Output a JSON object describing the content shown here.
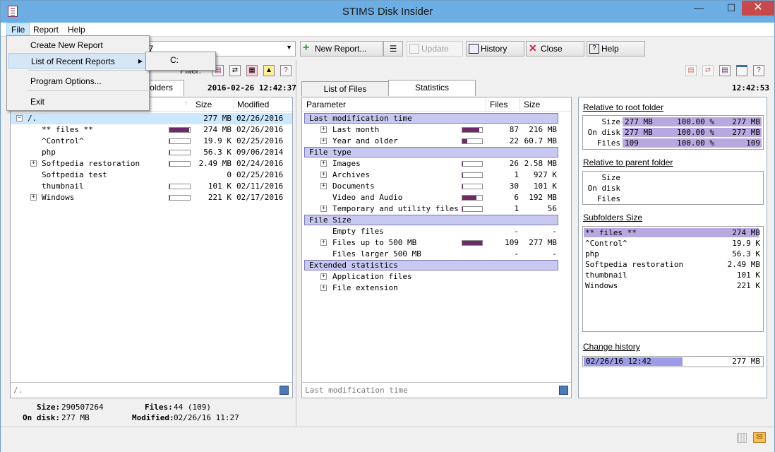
{
  "window": {
    "title": "STIMS Disk Insider"
  },
  "menubar": {
    "file": "File",
    "report": "Report",
    "help": "Help"
  },
  "file_menu": {
    "create": "Create New Report",
    "recent": "List of Recent Reports",
    "options": "Program Options...",
    "exit": "Exit"
  },
  "recent_submenu": {
    "item": "C:"
  },
  "toolbar": {
    "combo_value": "37",
    "new_report": "New Report...",
    "update": "Update",
    "history": "History",
    "close": "Close",
    "help": "Help"
  },
  "left": {
    "filter_label": "Filter:",
    "tab_folders": "olders",
    "datetime": "2016-02-26 12:42:37",
    "col_size": "Size",
    "col_modified": "Modified",
    "rows": [
      {
        "name": "/.",
        "size": "277 MB",
        "date": "02/26/2016",
        "fill": 0,
        "bar": false,
        "expand": "minus",
        "indent": 0
      },
      {
        "name": "** files **",
        "size": "274 MB",
        "date": "02/26/2016",
        "fill": 0.98,
        "bar": true,
        "expand": "",
        "indent": 1
      },
      {
        "name": "^Control^",
        "size": "19.9 K",
        "date": "02/25/2016",
        "fill": 0.02,
        "bar": true,
        "expand": "",
        "indent": 1
      },
      {
        "name": "php",
        "size": "56.3 K",
        "date": "09/06/2014",
        "fill": 0.02,
        "bar": true,
        "expand": "",
        "indent": 1
      },
      {
        "name": "Softpedia restoration",
        "size": "2.49 MB",
        "date": "02/24/2016",
        "fill": 0.03,
        "bar": true,
        "expand": "plus",
        "indent": 1
      },
      {
        "name": "Softpedia test",
        "size": "0",
        "date": "02/25/2016",
        "fill": 0,
        "bar": false,
        "expand": "",
        "indent": 1
      },
      {
        "name": "thumbnail",
        "size": "101 K",
        "date": "02/11/2016",
        "fill": 0.02,
        "bar": true,
        "expand": "",
        "indent": 1
      },
      {
        "name": "Windows",
        "size": "221 K",
        "date": "02/17/2016",
        "fill": 0.02,
        "bar": true,
        "expand": "plus",
        "indent": 1
      }
    ],
    "path": "/.",
    "info": {
      "size_label": "Size:",
      "size_val": "290507264",
      "ondisk_label": "On disk:",
      "ondisk_val": "277 MB",
      "files_label": "Files:",
      "files_val": "44 (109)",
      "modified_label": "Modified:",
      "modified_val": "02/26/16 11:27"
    }
  },
  "right": {
    "tab_files": "List of Files",
    "tab_stats": "Statistics",
    "time": "12:42:53",
    "col_param": "Parameter",
    "col_files": "Files",
    "col_size": "Size",
    "sections": [
      {
        "title": "Last modification time",
        "rows": [
          {
            "label": "Last month",
            "files": "87",
            "size": "216 MB",
            "fill": 0.85,
            "bar": true,
            "plus": true
          },
          {
            "label": "Year and older",
            "files": "22",
            "size": "60.7 MB",
            "fill": 0.25,
            "bar": true,
            "plus": true
          }
        ]
      },
      {
        "title": "File type",
        "rows": [
          {
            "label": "Images",
            "files": "26",
            "size": "2.58 MB",
            "fill": 0.02,
            "bar": true,
            "plus": true
          },
          {
            "label": "Archives",
            "files": "1",
            "size": "927 K",
            "fill": 0.02,
            "bar": true,
            "plus": true
          },
          {
            "label": "Documents",
            "files": "30",
            "size": "101 K",
            "fill": 0.02,
            "bar": true,
            "plus": true
          },
          {
            "label": "Video and Audio",
            "files": "6",
            "size": "192 MB",
            "fill": 0.7,
            "bar": true,
            "plus": false
          },
          {
            "label": "Temporary and utility files",
            "files": "1",
            "size": "56",
            "fill": 0.02,
            "bar": true,
            "plus": true
          }
        ]
      },
      {
        "title": "File Size",
        "rows": [
          {
            "label": "Empty files",
            "files": "-",
            "size": "-",
            "fill": 0,
            "bar": false,
            "plus": false
          },
          {
            "label": "Files up to 500 MB",
            "files": "109",
            "size": "277 MB",
            "fill": 1,
            "bar": true,
            "plus": true
          },
          {
            "label": "Files larger 500 MB",
            "files": "-",
            "size": "-",
            "fill": 0,
            "bar": false,
            "plus": false
          }
        ]
      },
      {
        "title": "Extended statistics",
        "rows": [
          {
            "label": "Application files",
            "files": "",
            "size": "",
            "fill": 0,
            "bar": false,
            "plus": true
          },
          {
            "label": "File extension",
            "files": "",
            "size": "",
            "fill": 0,
            "bar": false,
            "plus": true
          }
        ]
      }
    ],
    "footer": "Last modification time"
  },
  "side": {
    "rel_root": "Relative to root folder",
    "root_rows": [
      {
        "label": "Size",
        "a": "277 MB",
        "pct": "100.00 %",
        "b": "277 MB"
      },
      {
        "label": "On disk",
        "a": "277 MB",
        "pct": "100.00 %",
        "b": "277 MB"
      },
      {
        "label": "Files",
        "a": "109",
        "pct": "100.00 %",
        "b": "109"
      }
    ],
    "rel_parent": "Relative to parent folder",
    "parent_rows": [
      {
        "label": "Size"
      },
      {
        "label": "On disk"
      },
      {
        "label": "Files"
      }
    ],
    "subfolders": "Subfolders Size",
    "sub_rows": [
      {
        "name": "** files **",
        "size": "274 MB",
        "fill": 0.98
      },
      {
        "name": "^Control^",
        "size": "19.9 K",
        "fill": 0
      },
      {
        "name": "php",
        "size": "56.3 K",
        "fill": 0
      },
      {
        "name": "Softpedia restoration",
        "size": "2.49 MB",
        "fill": 0
      },
      {
        "name": "thumbnail",
        "size": "101 K",
        "fill": 0
      },
      {
        "name": "Windows",
        "size": "221 K",
        "fill": 0
      }
    ],
    "change_history": "Change history",
    "hist_date": "02/26/16 12:42",
    "hist_size": "277 MB"
  },
  "colors": {
    "accent": "#6e2a66",
    "section": "#c8c8f0",
    "selection": "#cce8ff",
    "title": "#6caee4"
  }
}
